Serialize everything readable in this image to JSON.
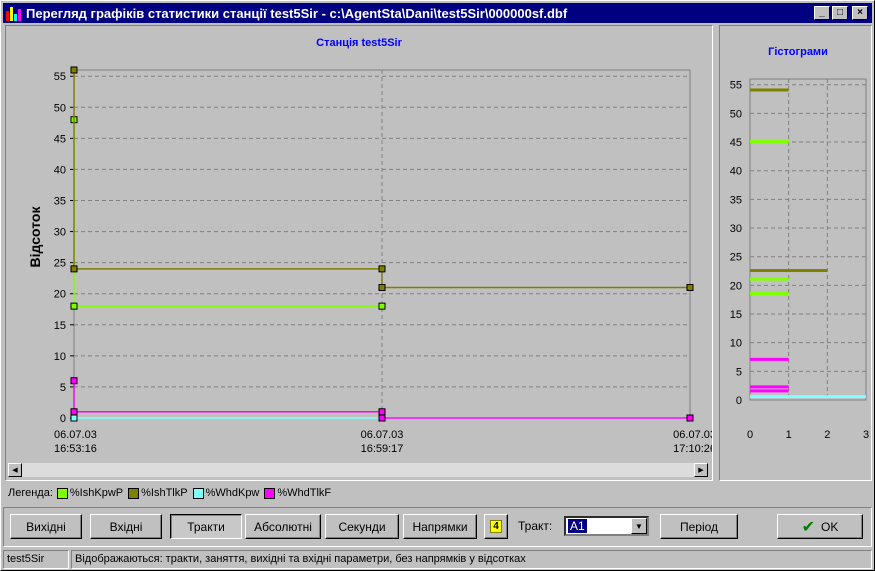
{
  "window": {
    "title": "Перегляд графіків статистики станції test5Sir - c:\\AgentSta\\Dani\\test5Sir\\000000sf.dbf"
  },
  "main_chart": {
    "title": "Станція test5Sir",
    "ylabel": "Відсоток",
    "y_ticks": [
      "0",
      "5",
      "10",
      "15",
      "20",
      "25",
      "30",
      "35",
      "40",
      "45",
      "50",
      "55"
    ],
    "x_ticks": [
      {
        "date": "06.07.03",
        "time": "16:53:16"
      },
      {
        "date": "06.07.03",
        "time": "16:59:17"
      },
      {
        "date": "06.07.03",
        "time": "17:10:26"
      }
    ]
  },
  "hist_chart": {
    "title": "Гістограми",
    "y_ticks": [
      "0",
      "5",
      "10",
      "15",
      "20",
      "25",
      "30",
      "35",
      "40",
      "45",
      "50",
      "55"
    ],
    "x_ticks": [
      "0",
      "1",
      "2",
      "3"
    ]
  },
  "chart_data": [
    {
      "type": "line",
      "title": "Станція test5Sir",
      "ylabel": "Відсоток",
      "xlabel": "",
      "ylim": [
        0,
        56
      ],
      "x": [
        "06.07.03 16:53:16",
        "06.07.03 16:59:17",
        "06.07.03 17:10:26"
      ],
      "series": [
        {
          "name": "%IshKpwP",
          "color": "#80ff00",
          "points": [
            [
              0,
              48
            ],
            [
              0,
              18
            ],
            [
              1,
              18
            ]
          ]
        },
        {
          "name": "%IshTlkP",
          "color": "#808000",
          "points": [
            [
              0,
              56
            ],
            [
              0,
              24
            ],
            [
              1,
              24
            ],
            [
              1,
              21
            ],
            [
              2,
              21
            ]
          ]
        },
        {
          "name": "%WhdKpw",
          "color": "#80ffff",
          "points": [
            [
              0,
              0
            ],
            [
              1,
              0
            ],
            [
              2,
              0
            ]
          ]
        },
        {
          "name": "%WhdTlkF",
          "color": "#ff00ff",
          "points": [
            [
              0,
              6
            ],
            [
              0,
              1
            ],
            [
              1,
              1
            ],
            [
              1,
              0
            ],
            [
              2,
              0
            ]
          ]
        }
      ],
      "grid": true
    },
    {
      "type": "bar",
      "title": "Гістограми",
      "orientation": "horizontal",
      "xlim": [
        0,
        3
      ],
      "ylim": [
        0,
        56
      ],
      "bars": [
        {
          "y": 54,
          "len": 1,
          "color": "#808000"
        },
        {
          "y": 45,
          "len": 1,
          "color": "#80ff00"
        },
        {
          "y": 22.5,
          "len": 2,
          "color": "#808000"
        },
        {
          "y": 21,
          "len": 1,
          "color": "#80ff00"
        },
        {
          "y": 18.5,
          "len": 1,
          "color": "#80ff00"
        },
        {
          "y": 7,
          "len": 1,
          "color": "#ff00ff"
        },
        {
          "y": 2.2,
          "len": 1,
          "color": "#ff00ff"
        },
        {
          "y": 1.5,
          "len": 1,
          "color": "#ff00ff"
        },
        {
          "y": 0.5,
          "len": 3,
          "color": "#80ffff"
        }
      ],
      "grid": true
    }
  ],
  "legend": {
    "label": "Легенда:",
    "items": [
      {
        "name": "%IshKpwP",
        "color": "#80ff00"
      },
      {
        "name": "%IshTlkP",
        "color": "#808000"
      },
      {
        "name": "%WhdKpw",
        "color": "#80ffff"
      },
      {
        "name": "%WhdTlkF",
        "color": "#ff00ff"
      }
    ]
  },
  "toolbar": {
    "outgoing": "Вихідні",
    "incoming": "Вхідні",
    "trunks": "Тракти",
    "absolute": "Абсолютні",
    "seconds": "Секунди",
    "directions": "Напрямки",
    "count_badge": "4",
    "trunk_label": "Тракт:",
    "trunk_value": "A1",
    "period": "Період",
    "ok": "OK"
  },
  "status": {
    "station": "test5Sir",
    "message": "Відображаються: тракти, заняття, вихідні та вхідні параметри, без напрямків у відсотках"
  }
}
